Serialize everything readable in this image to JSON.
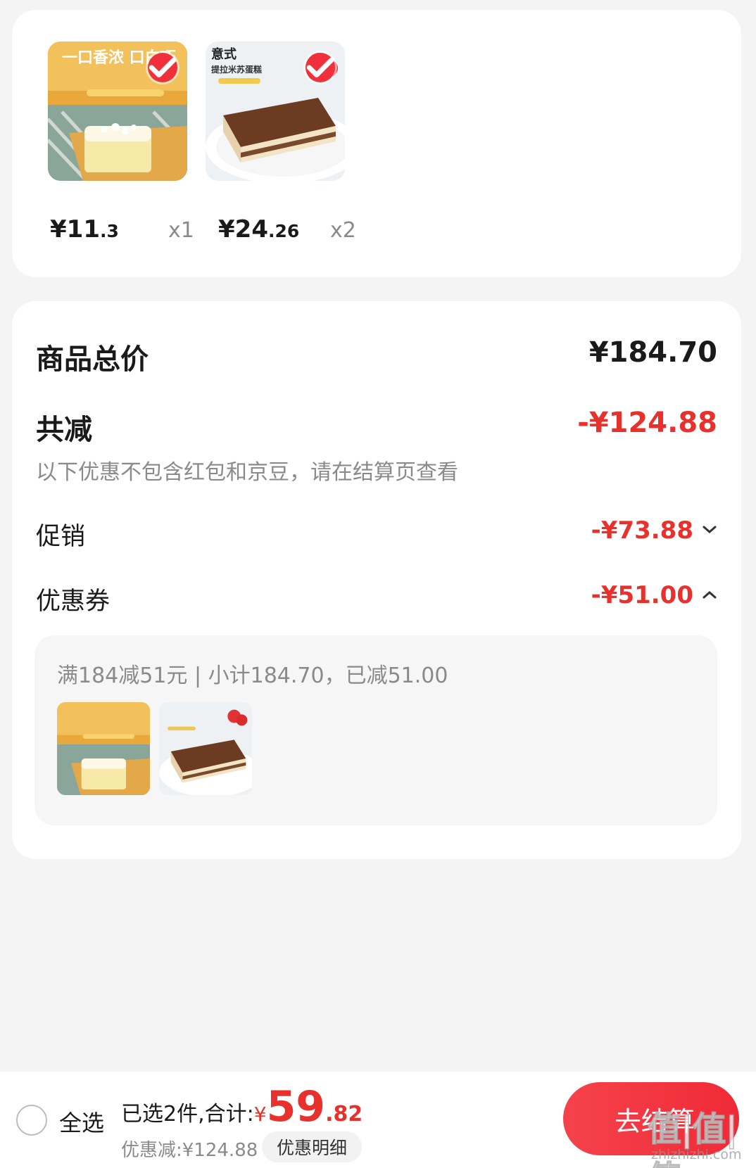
{
  "products": [
    {
      "banner_text": "一口香浓 口白巧",
      "price_int": "¥11",
      "price_dec": ".3",
      "qty": "x1"
    },
    {
      "banner_text_1": "意式",
      "banner_text_2": "提拉米苏蛋糕",
      "price_int": "¥24",
      "price_dec": ".26",
      "qty": "x2"
    }
  ],
  "summary": {
    "total_label": "商品总价",
    "total_value": "¥184.70",
    "discount_label": "共减",
    "discount_value": "-¥124.88",
    "note": "以下优惠不包含红包和京豆，请在结算页查看",
    "promo_label": "促销",
    "promo_value": "-¥73.88",
    "coupon_label": "优惠券",
    "coupon_value": "-¥51.00",
    "coupon_detail": "满184减51元 | 小计184.70，已减51.00"
  },
  "bottom": {
    "select_all": "全选",
    "selected_text": "已选2件,合计:",
    "currency": "¥",
    "total_int": "59",
    "total_dec": ".82",
    "discount_text": "优惠减:¥124.88",
    "detail_button": "优惠明细",
    "checkout_button": "去结算"
  },
  "watermark": {
    "text": "值|值|值",
    "sub": "zhizhizhi.com"
  },
  "colors": {
    "accent_red": "#f0303a",
    "price_red": "#e8312c",
    "gray_text": "#8a8a8a"
  }
}
